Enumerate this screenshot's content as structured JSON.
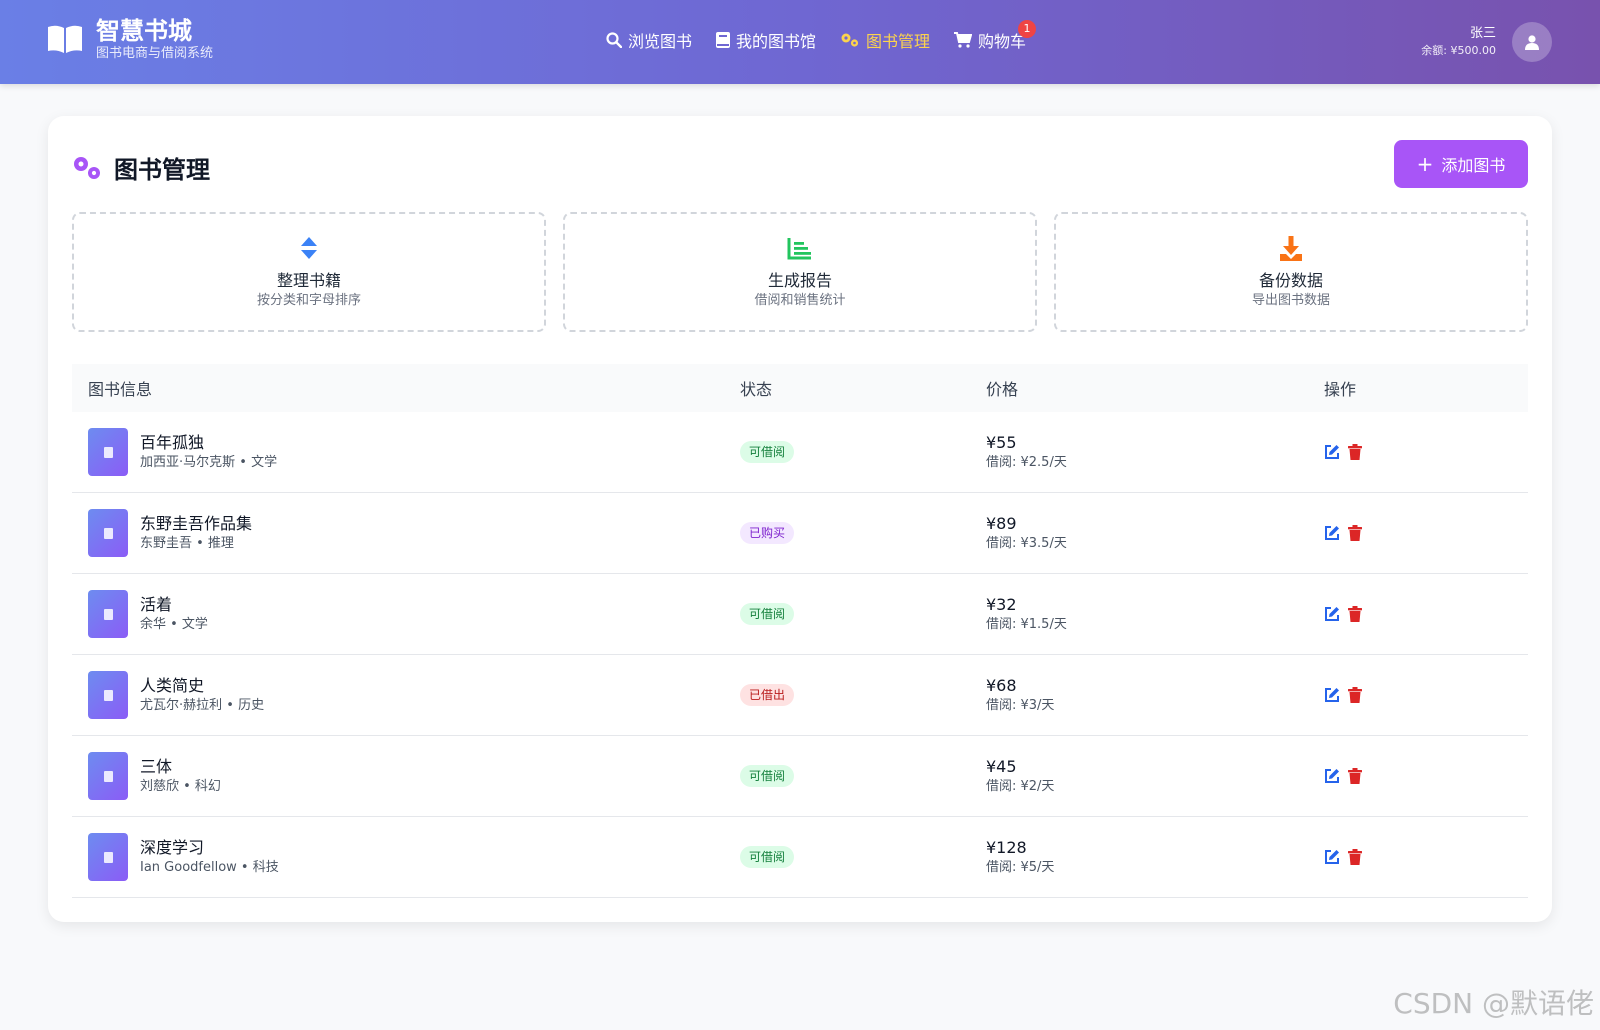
{
  "header": {
    "brand_title": "智慧书城",
    "brand_subtitle": "图书电商与借阅系统",
    "nav": [
      {
        "label": "浏览图书",
        "icon": "search-icon",
        "active": false
      },
      {
        "label": "我的图书馆",
        "icon": "book-icon",
        "active": false
      },
      {
        "label": "图书管理",
        "icon": "gears-icon",
        "active": true
      },
      {
        "label": "购物车",
        "icon": "cart-icon",
        "active": false
      }
    ],
    "cart_count": "1",
    "user_name": "张三",
    "user_balance": "余额: ¥500.00"
  },
  "page": {
    "title": "图书管理",
    "add_button": "添加图书"
  },
  "tools": [
    {
      "label": "整理书籍",
      "desc": "按分类和字母排序",
      "icon": "sort-icon",
      "color": "#3b82f6"
    },
    {
      "label": "生成报告",
      "desc": "借阅和销售统计",
      "icon": "chart-icon",
      "color": "#22c55e"
    },
    {
      "label": "备份数据",
      "desc": "导出图书数据",
      "icon": "download-icon",
      "color": "#f97316"
    }
  ],
  "table": {
    "headers": {
      "info": "图书信息",
      "status": "状态",
      "price": "价格",
      "ops": "操作"
    },
    "rows": [
      {
        "title": "百年孤独",
        "meta": "加西亚·马尔克斯 • 文学",
        "status": "可借阅",
        "status_type": "green",
        "price": "¥55",
        "rent": "借阅: ¥2.5/天"
      },
      {
        "title": "东野圭吾作品集",
        "meta": "东野圭吾 • 推理",
        "status": "已购买",
        "status_type": "purple",
        "price": "¥89",
        "rent": "借阅: ¥3.5/天"
      },
      {
        "title": "活着",
        "meta": "余华 • 文学",
        "status": "可借阅",
        "status_type": "green",
        "price": "¥32",
        "rent": "借阅: ¥1.5/天"
      },
      {
        "title": "人类简史",
        "meta": "尤瓦尔·赫拉利 • 历史",
        "status": "已借出",
        "status_type": "red",
        "price": "¥68",
        "rent": "借阅: ¥3/天"
      },
      {
        "title": "三体",
        "meta": "刘慈欣 • 科幻",
        "status": "可借阅",
        "status_type": "green",
        "price": "¥45",
        "rent": "借阅: ¥2/天"
      },
      {
        "title": "深度学习",
        "meta": "Ian Goodfellow • 科技",
        "status": "可借阅",
        "status_type": "green",
        "price": "¥128",
        "rent": "借阅: ¥5/天"
      }
    ]
  },
  "watermark": "CSDN @默语佬"
}
